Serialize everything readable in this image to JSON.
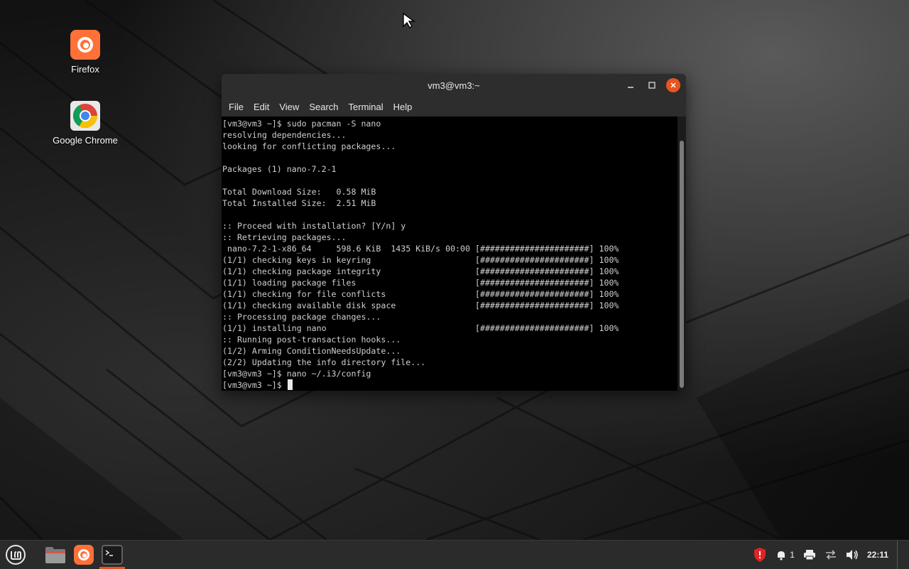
{
  "desktop": {
    "icons": [
      {
        "label": "Firefox",
        "icon": "firefox-icon"
      },
      {
        "label": "Google Chrome",
        "icon": "chrome-icon"
      }
    ]
  },
  "window": {
    "title": "vm3@vm3:~",
    "menu": [
      "File",
      "Edit",
      "View",
      "Search",
      "Terminal",
      "Help"
    ],
    "controls": [
      "minimize",
      "maximize",
      "close"
    ]
  },
  "terminal": {
    "lines": [
      "[vm3@vm3 ~]$ sudo pacman -S nano",
      "resolving dependencies...",
      "looking for conflicting packages...",
      "",
      "Packages (1) nano-7.2-1",
      "",
      "Total Download Size:   0.58 MiB",
      "Total Installed Size:  2.51 MiB",
      "",
      ":: Proceed with installation? [Y/n] y",
      ":: Retrieving packages...",
      " nano-7.2-1-x86_64     598.6 KiB  1435 KiB/s 00:00 [######################] 100%",
      "(1/1) checking keys in keyring                     [######################] 100%",
      "(1/1) checking package integrity                   [######################] 100%",
      "(1/1) loading package files                        [######################] 100%",
      "(1/1) checking for file conflicts                  [######################] 100%",
      "(1/1) checking available disk space                [######################] 100%",
      ":: Processing package changes...",
      "(1/1) installing nano                              [######################] 100%",
      ":: Running post-transaction hooks...",
      "(1/2) Arming ConditionNeedsUpdate...",
      "(2/2) Updating the info directory file...",
      "[vm3@vm3 ~]$ nano ~/.i3/config"
    ],
    "prompt": "[vm3@vm3 ~]$ "
  },
  "taskbar": {
    "launchers": [
      "menu-icon",
      "files-icon",
      "firefox-icon",
      "terminal-icon"
    ],
    "notification_count": "1",
    "clock": "22:11"
  },
  "colors": {
    "accent": "#e95420",
    "firefox": "#ff7139",
    "terminal_bg": "#000000",
    "titlebar": "#2d2d2d",
    "taskbar": "#2b2b2b"
  }
}
